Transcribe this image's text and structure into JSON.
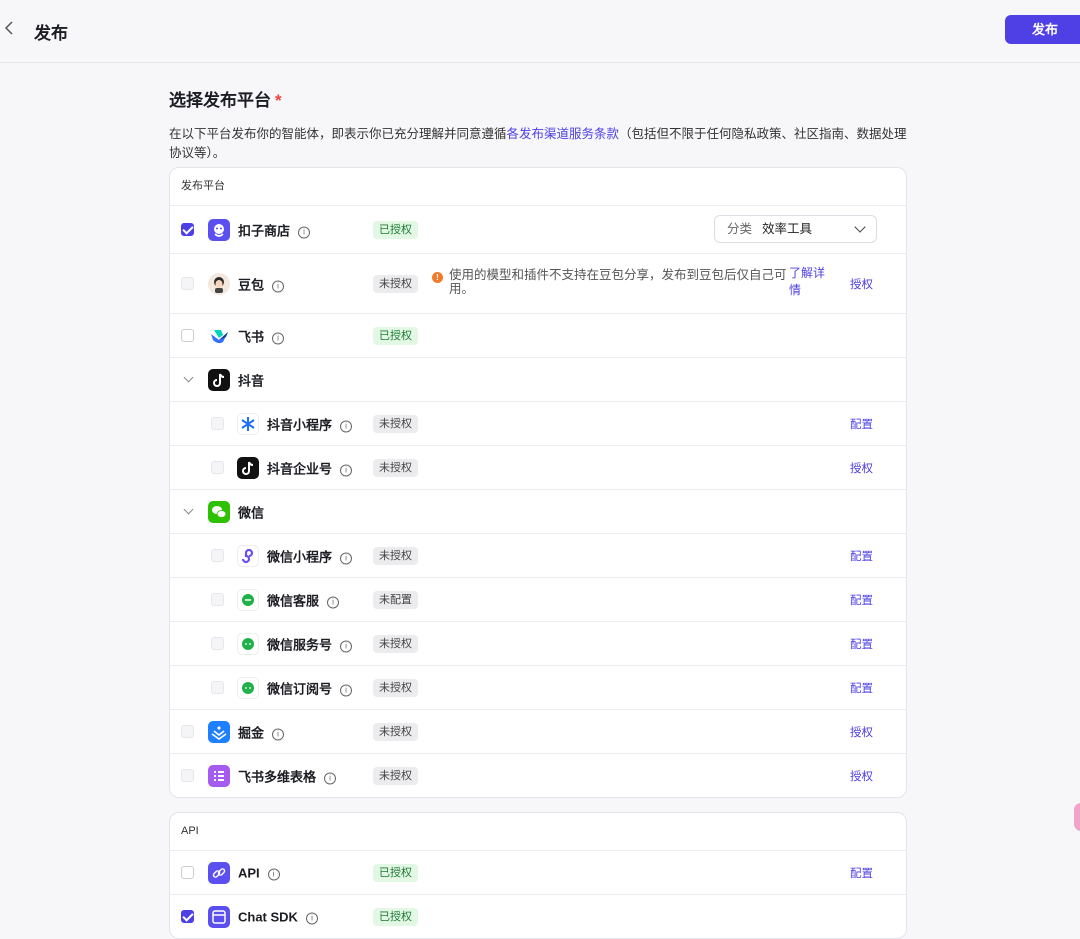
{
  "header": {
    "back_icon": "chevron-left-icon",
    "title": "发布",
    "publish_label": "发布"
  },
  "section": {
    "title": "选择发布平台",
    "required_mark": "*",
    "desc_prefix": "在以下平台发布你的智能体，即表示你已充分理解并同意遵循",
    "desc_link": "各发布渠道服务条款",
    "desc_suffix": "（包括但不限于任何隐私政策、社区指南、数据处理协议等）。"
  },
  "platform_card": {
    "header": "发布平台",
    "coze": {
      "name": "扣子商店",
      "status": "已授权",
      "category_prefix": "分类",
      "category_value": "效率工具"
    },
    "doubao": {
      "name": "豆包",
      "status": "未授权",
      "warning": "使用的模型和插件不支持在豆包分享，发布到豆包后仅自己可用。",
      "learn_more": "了解详情",
      "action": "授权"
    },
    "feishu": {
      "name": "飞书",
      "status": "已授权"
    },
    "douyin_group": {
      "name": "抖音"
    },
    "douyin_mini": {
      "name": "抖音小程序",
      "status": "未授权",
      "action": "配置"
    },
    "douyin_biz": {
      "name": "抖音企业号",
      "status": "未授权",
      "action": "授权"
    },
    "wechat_group": {
      "name": "微信"
    },
    "wechat_mini": {
      "name": "微信小程序",
      "status": "未授权",
      "action": "配置"
    },
    "wechat_kf": {
      "name": "微信客服",
      "status": "未配置",
      "action": "配置"
    },
    "wechat_service": {
      "name": "微信服务号",
      "status": "未授权",
      "action": "配置"
    },
    "wechat_sub": {
      "name": "微信订阅号",
      "status": "未授权",
      "action": "配置"
    },
    "juejin": {
      "name": "掘金",
      "status": "未授权",
      "action": "授权"
    },
    "feishu_base": {
      "name": "飞书多维表格",
      "status": "未授权",
      "action": "授权"
    }
  },
  "api_card": {
    "header": "API",
    "api": {
      "name": "API",
      "status": "已授权",
      "action": "配置"
    },
    "chat_sdk": {
      "name": "Chat SDK",
      "status": "已授权"
    }
  },
  "colors": {
    "accent": "#4e40e5",
    "authorized_bg": "#e3f7e5",
    "unauthorized_bg": "#ececef",
    "warning": "#f07b2a"
  }
}
